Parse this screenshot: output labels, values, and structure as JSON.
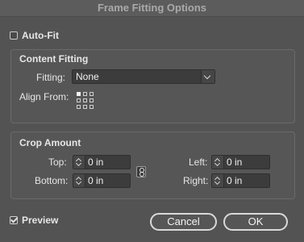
{
  "window": {
    "title": "Frame Fitting Options"
  },
  "auto_fit": {
    "label": "Auto-Fit",
    "checked": false
  },
  "content_fitting": {
    "title": "Content Fitting",
    "fitting_label": "Fitting:",
    "fitting_value": "None",
    "align_from_label": "Align From:",
    "reference_point_selected": "top-left"
  },
  "crop_amount": {
    "title": "Crop Amount",
    "top_label": "Top:",
    "top_value": "0 in",
    "bottom_label": "Bottom:",
    "bottom_value": "0 in",
    "left_label": "Left:",
    "left_value": "0 in",
    "right_label": "Right:",
    "right_value": "0 in"
  },
  "preview": {
    "label": "Preview",
    "checked": true
  },
  "buttons": {
    "cancel": "Cancel",
    "ok": "OK"
  },
  "icons": {
    "checkbox": "checkbox-icon",
    "dropdown": "chevron-down-icon",
    "reference_point": "reference-point-grid-icon",
    "spinner": "stepper-icon",
    "constrain": "link-chain-icon"
  }
}
